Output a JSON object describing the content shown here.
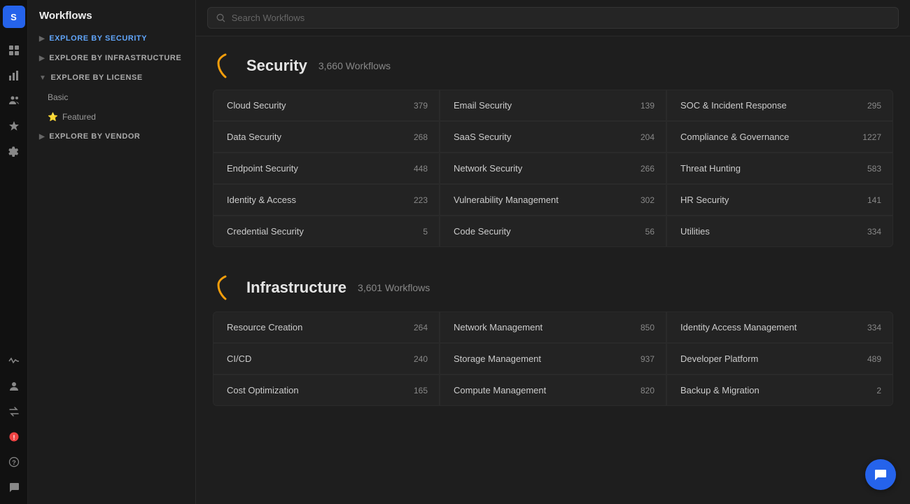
{
  "app": {
    "title": "Workflows"
  },
  "search": {
    "placeholder": "Search Workflows"
  },
  "sidebar": {
    "title": "Workflows",
    "sections": [
      {
        "id": "by-security",
        "label": "EXPLORE BY SECURITY",
        "expanded": true,
        "active": true,
        "sub_items": [
          {
            "id": "basic",
            "label": "Basic",
            "active": false
          },
          {
            "id": "featured",
            "label": "Featured",
            "active": false,
            "has_star": true
          }
        ]
      },
      {
        "id": "by-infrastructure",
        "label": "EXPLORE BY INFRASTRUCTURE",
        "expanded": false,
        "active": false,
        "sub_items": []
      },
      {
        "id": "by-license",
        "label": "EXPLORE BY LICENSE",
        "expanded": false,
        "active": false,
        "sub_items": []
      },
      {
        "id": "by-vendor",
        "label": "EXPLORE BY VENDOR",
        "expanded": false,
        "active": false,
        "sub_items": []
      }
    ]
  },
  "icon_bar": {
    "items": [
      {
        "id": "logo",
        "icon": "S",
        "active": true
      },
      {
        "id": "grid",
        "icon": "⊞",
        "active": false
      },
      {
        "id": "chart",
        "icon": "📊",
        "active": false
      },
      {
        "id": "people",
        "icon": "👥",
        "active": false
      },
      {
        "id": "star",
        "icon": "☆",
        "active": false
      },
      {
        "id": "settings2",
        "icon": "⚙",
        "active": false
      }
    ],
    "bottom_items": [
      {
        "id": "activity",
        "icon": "↺",
        "active": false
      },
      {
        "id": "users",
        "icon": "👤",
        "active": false
      },
      {
        "id": "refresh",
        "icon": "⇄",
        "active": false
      },
      {
        "id": "alert",
        "icon": "🔴",
        "active": false,
        "notif": true
      },
      {
        "id": "help",
        "icon": "?",
        "active": false
      },
      {
        "id": "chat-icon",
        "icon": "💬",
        "active": false
      }
    ]
  },
  "sections": [
    {
      "id": "security",
      "title": "Security",
      "count": "3,660 Workflows",
      "categories": [
        {
          "name": "Cloud Security",
          "count": 379
        },
        {
          "name": "Email Security",
          "count": 139
        },
        {
          "name": "SOC & Incident Response",
          "count": 295
        },
        {
          "name": "Data Security",
          "count": 268
        },
        {
          "name": "SaaS Security",
          "count": 204
        },
        {
          "name": "Compliance & Governance",
          "count": 1227
        },
        {
          "name": "Endpoint Security",
          "count": 448
        },
        {
          "name": "Network Security",
          "count": 266
        },
        {
          "name": "Threat Hunting",
          "count": 583
        },
        {
          "name": "Identity & Access",
          "count": 223
        },
        {
          "name": "Vulnerability Management",
          "count": 302
        },
        {
          "name": "HR Security",
          "count": 141
        },
        {
          "name": "Credential Security",
          "count": 5
        },
        {
          "name": "Code Security",
          "count": 56
        },
        {
          "name": "Utilities",
          "count": 334
        }
      ]
    },
    {
      "id": "infrastructure",
      "title": "Infrastructure",
      "count": "3,601 Workflows",
      "categories": [
        {
          "name": "Resource Creation",
          "count": 264
        },
        {
          "name": "Network Management",
          "count": 850
        },
        {
          "name": "Identity Access Management",
          "count": 334
        },
        {
          "name": "CI/CD",
          "count": 240
        },
        {
          "name": "Storage Management",
          "count": 937
        },
        {
          "name": "Developer Platform",
          "count": 489
        },
        {
          "name": "Cost Optimization",
          "count": 165
        },
        {
          "name": "Compute Management",
          "count": 820
        },
        {
          "name": "Backup & Migration",
          "count": 2
        }
      ]
    }
  ],
  "chat_fab_label": "💬"
}
